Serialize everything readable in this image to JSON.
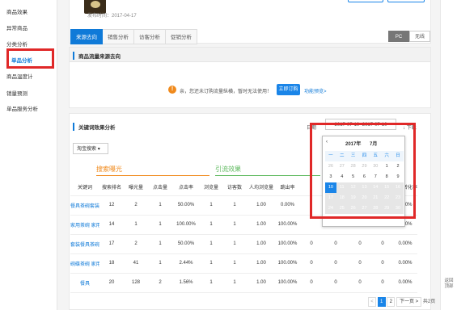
{
  "sidebar": {
    "items": [
      "商品效果",
      "异常商品",
      "分类分析",
      "单品分析",
      "商品温度计",
      "销量预测",
      "单品服务分析"
    ]
  },
  "product": {
    "publish_time": "发布时间：2017-04-17"
  },
  "tabs": [
    "来源去向",
    "销售分析",
    "访客分析",
    "促销分析"
  ],
  "device": {
    "pc": "PC",
    "wireless": "无线"
  },
  "flow_section": {
    "title": "商品流量来源去向",
    "notice": "亲，您还未订购流量纵横，暂时无法使用！",
    "subscribe": "立即订购",
    "preview": "功能预览>"
  },
  "kw_section": {
    "title": "关键词效果分析",
    "date_label": "日期",
    "date_range": "2017-07-10~2017-07-10",
    "download": "下载",
    "source": "淘宝搜索"
  },
  "groups": {
    "search": "搜索曝光",
    "traffic": "引流效果"
  },
  "table": {
    "headers": [
      "关键词",
      "搜索排名",
      "曝光量",
      "点击量",
      "点击率",
      "浏览量",
      "访客数",
      "人均浏览量",
      "跳出率",
      "",
      "",
      "",
      "",
      "支付转化率"
    ],
    "rows": [
      [
        "餐具茶碗套装",
        "12",
        "2",
        "1",
        "50.00%",
        "1",
        "1",
        "1.00",
        "0.00%",
        "",
        "",
        "",
        "",
        "0.00%"
      ],
      [
        "家用茶碗 家用",
        "14",
        "1",
        "1",
        "100.00%",
        "1",
        "1",
        "1.00",
        "100.00%",
        "",
        "",
        "",
        "",
        "0.00%"
      ],
      [
        "套装餐具茶碗",
        "17",
        "2",
        "1",
        "50.00%",
        "1",
        "1",
        "1.00",
        "100.00%",
        "0",
        "0",
        "0",
        "0",
        "0.00%"
      ],
      [
        "碗碟茶碗 家用",
        "18",
        "41",
        "1",
        "2.44%",
        "1",
        "1",
        "1.00",
        "100.00%",
        "0",
        "0",
        "0",
        "0",
        "0.00%"
      ],
      [
        "餐具",
        "20",
        "128",
        "2",
        "1.56%",
        "1",
        "1",
        "1.00",
        "100.00%",
        "0",
        "0",
        "0",
        "0",
        "0.00%"
      ]
    ]
  },
  "calendar": {
    "year": "2017年",
    "month": "7月",
    "weekdays": [
      "一",
      "二",
      "三",
      "四",
      "五",
      "六",
      "日"
    ],
    "days": [
      "26",
      "27",
      "28",
      "29",
      "30",
      "1",
      "2",
      "3",
      "4",
      "5",
      "6",
      "7",
      "8",
      "9",
      "10",
      "11",
      "12",
      "13",
      "14",
      "15",
      "16",
      "17",
      "18",
      "19",
      "20",
      "21",
      "22",
      "23",
      "24",
      "25",
      "26",
      "27",
      "28",
      "29",
      "30"
    ],
    "selected": "10"
  },
  "pager": {
    "prev": "<",
    "page1": "1",
    "page2": "2",
    "next": "下一页 >",
    "total": "共2页"
  },
  "rightbar": {
    "back": "返回",
    "top": "顶部"
  }
}
